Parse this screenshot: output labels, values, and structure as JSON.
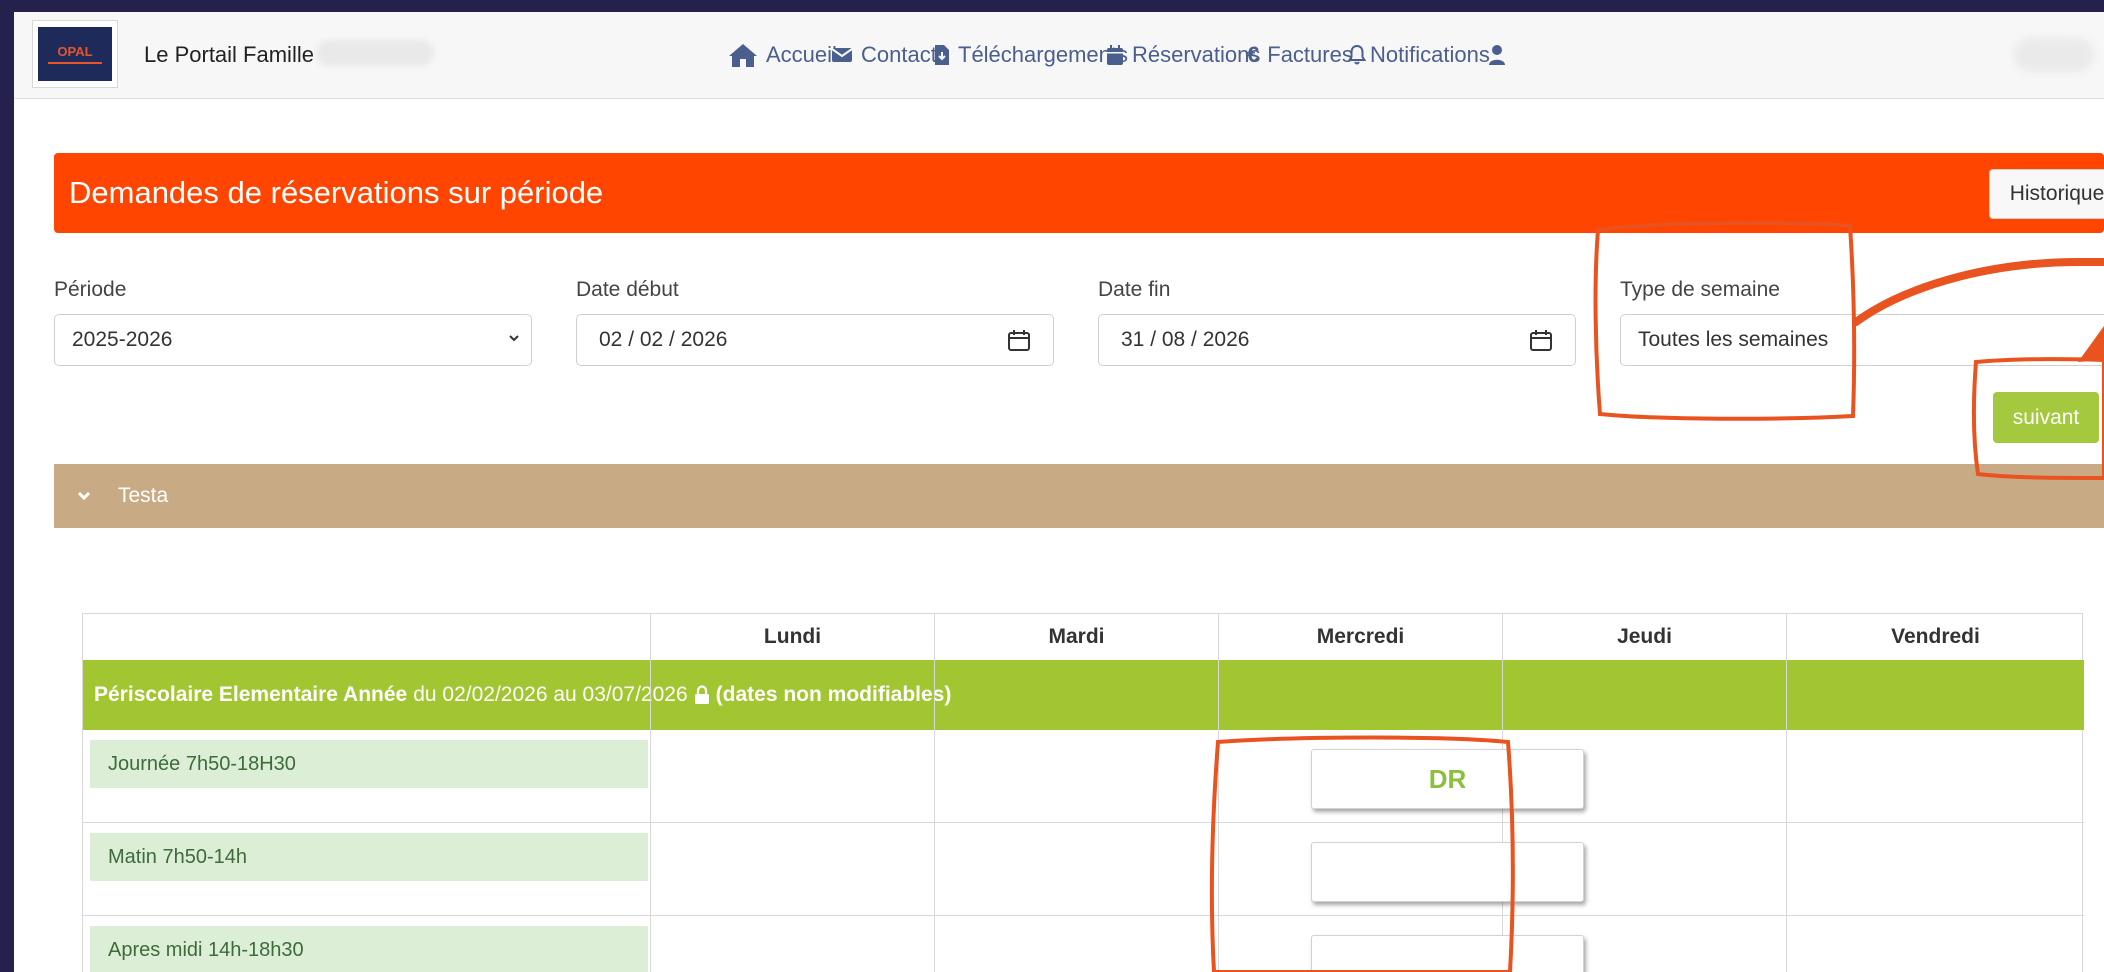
{
  "nav": {
    "brand": "Le Portail Famille",
    "items": [
      {
        "label": "Accueil",
        "icon": "home-icon"
      },
      {
        "label": "Contact",
        "icon": "envelope-icon"
      },
      {
        "label": "Téléchargements",
        "icon": "download-file-icon"
      },
      {
        "label": "Réservations",
        "icon": "calendar-icon"
      },
      {
        "label": "Factures",
        "icon": "euro-icon"
      },
      {
        "label": "Notifications",
        "icon": "bell-icon"
      }
    ],
    "logo_text": "OPAL"
  },
  "header": {
    "title": "Demandes de réservations sur période",
    "historique_label": "Historique"
  },
  "form": {
    "periode_label": "Période",
    "periode_value": "2025-2026",
    "date_debut_label": "Date début",
    "date_debut_value": "02 / 02 / 2026",
    "date_fin_label": "Date fin",
    "date_fin_value": "31 / 08 / 2026",
    "type_semaine_label": "Type de semaine",
    "type_semaine_value": "Toutes les semaines",
    "suivant_label": "suivant"
  },
  "child": {
    "name": "Testa"
  },
  "table": {
    "days": [
      "Lundi",
      "Mardi",
      "Mercredi",
      "Jeudi",
      "Vendredi"
    ],
    "group": {
      "name": "Périscolaire Elementaire Année",
      "dates": "du 02/02/2026 au 03/07/2026",
      "note": "(dates non modifiables)"
    },
    "rows": [
      {
        "label": "Journée 7h50-18H30",
        "mercredi": "DR"
      },
      {
        "label": "Matin 7h50-14h",
        "mercredi": ""
      },
      {
        "label": "Apres midi 14h-18h30",
        "mercredi": ""
      }
    ]
  },
  "colors": {
    "header": "#ff4500",
    "accordion": "#c8ab85",
    "group": "#a2c632",
    "suivant": "#a4c93e",
    "nav_text": "#4a5f8d",
    "annotation": "#e8531f"
  }
}
